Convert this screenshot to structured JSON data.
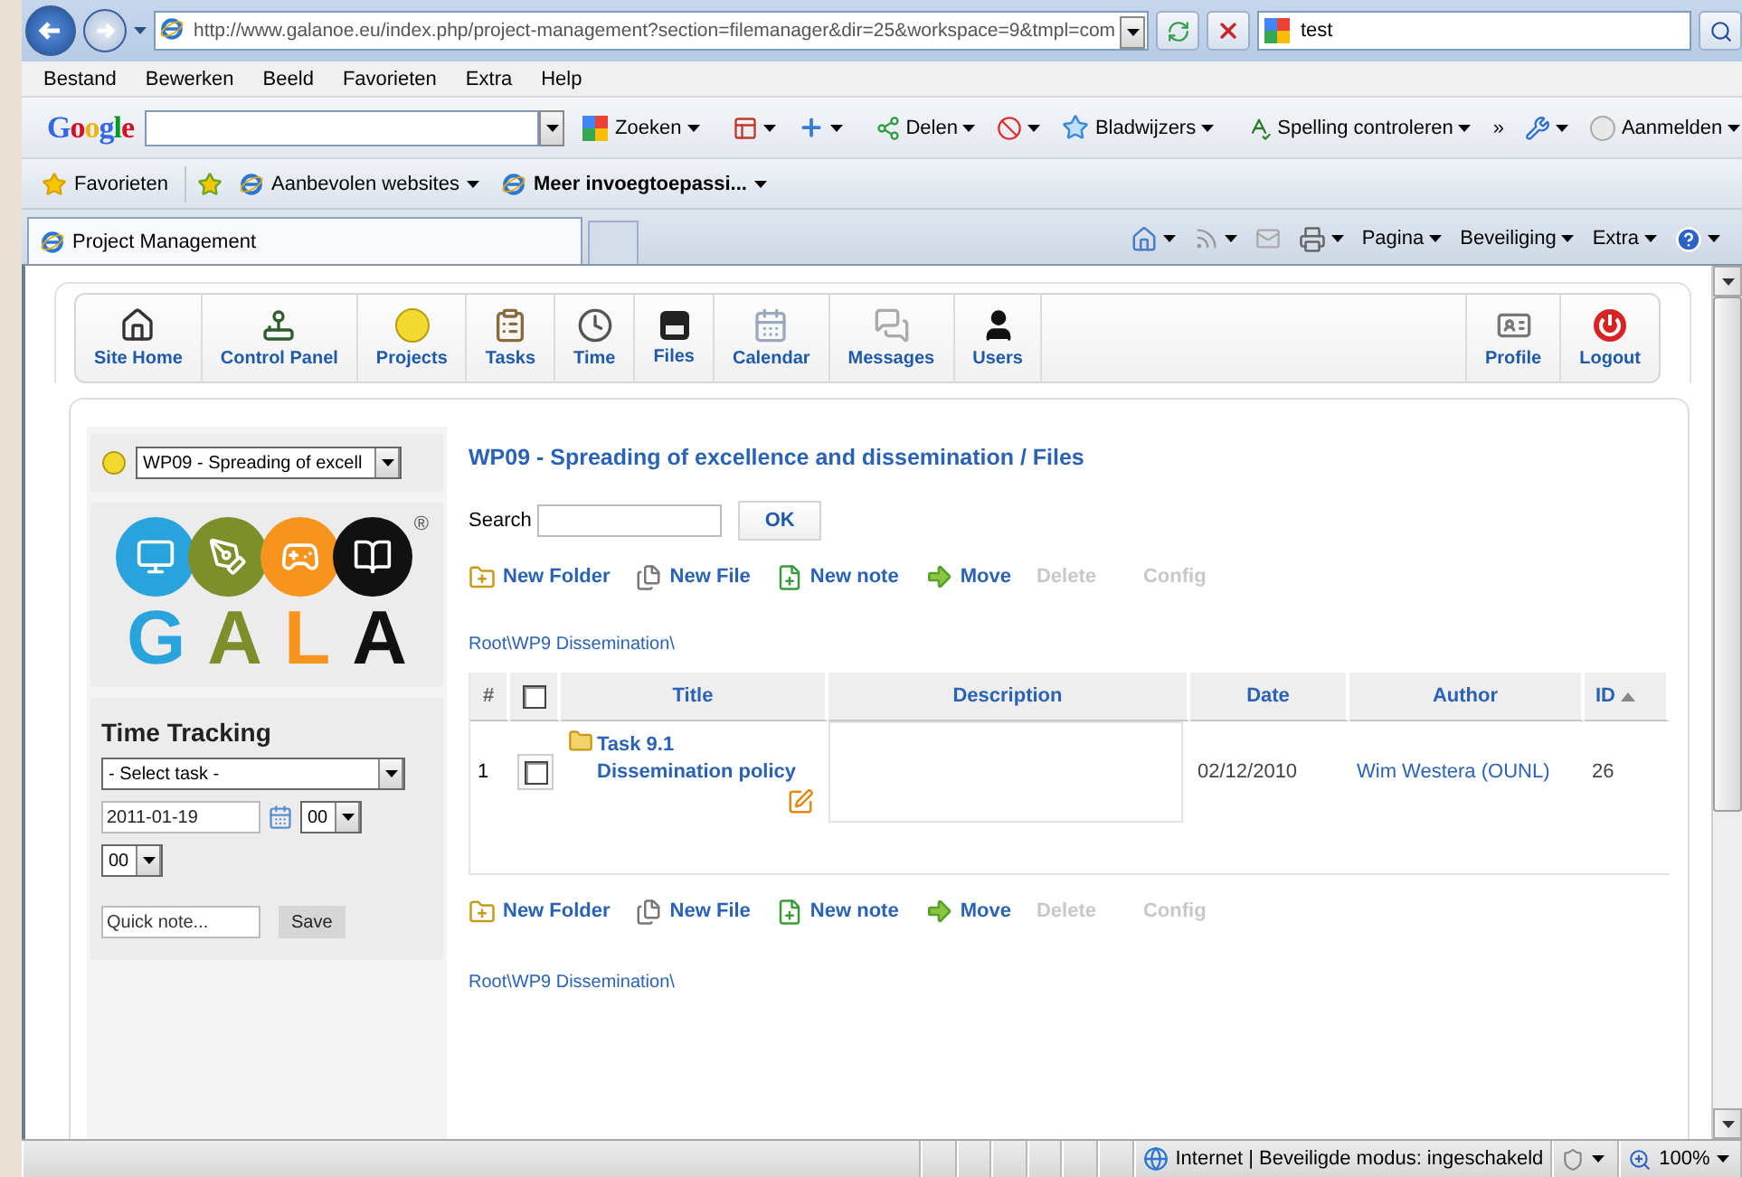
{
  "browser": {
    "address": "http://www.galanoe.eu/index.php/project-management?section=filemanager&dir=25&workspace=9&tmpl=com",
    "search": "test",
    "menu": [
      "Bestand",
      "Bewerken",
      "Beeld",
      "Favorieten",
      "Extra",
      "Help"
    ],
    "google_toolbar": {
      "logo": "Google",
      "items": [
        {
          "label": "Zoeken",
          "kind": "search"
        },
        {
          "kind": "page-tools"
        },
        {
          "kind": "add"
        },
        {
          "label": "Delen",
          "kind": "share"
        },
        {
          "kind": "blocker"
        },
        {
          "label": "Bladwijzers",
          "kind": "bookmarks"
        },
        {
          "label": "Spelling controleren",
          "kind": "spelling"
        },
        {
          "label": "»",
          "kind": "more"
        },
        {
          "kind": "wrench"
        },
        {
          "label": "Aanmelden",
          "kind": "signin"
        }
      ]
    },
    "favorites_bar": {
      "label": "Favorieten",
      "items": [
        {
          "label": "Aanbevolen websites",
          "bold": false
        },
        {
          "label": "Meer invoegtoepassi...",
          "bold": true
        }
      ]
    },
    "tabs": [
      {
        "label": "Project Management",
        "selected": true
      }
    ],
    "command_bar": [
      "Pagina",
      "Beveiliging",
      "Extra"
    ],
    "status_bar": {
      "zone": "Internet | Beveiligde modus: ingeschakeld",
      "zoom": "100%"
    }
  },
  "nav": {
    "left": [
      {
        "label": "Site Home",
        "kind": "home"
      },
      {
        "label": "Control Panel",
        "kind": "control"
      },
      {
        "label": "Projects",
        "kind": "projects"
      },
      {
        "label": "Tasks",
        "kind": "tasks"
      },
      {
        "label": "Time",
        "kind": "time"
      },
      {
        "label": "Files",
        "kind": "files"
      },
      {
        "label": "Calendar",
        "kind": "calendar"
      },
      {
        "label": "Messages",
        "kind": "messages"
      },
      {
        "label": "Users",
        "kind": "users"
      }
    ],
    "right": [
      {
        "label": "Profile",
        "kind": "profile"
      },
      {
        "label": "Logout",
        "kind": "logout"
      }
    ]
  },
  "sidebar": {
    "project_select": "WP09 - Spreading of excell",
    "logo": {
      "letters": [
        "G",
        "A",
        "L",
        "A"
      ],
      "mark": "®"
    },
    "time_tracking": {
      "title": "Time Tracking",
      "task_select": "- Select task -",
      "date": "2011-01-19",
      "hour": "00",
      "minute": "00",
      "quick_note": {
        "placeholder": "Quick note..."
      },
      "save": "Save"
    }
  },
  "main": {
    "title": "WP09 - Spreading of excellence and dissemination / Files",
    "search": {
      "label": "Search",
      "button": "OK"
    },
    "actions_top": [
      {
        "label": "New Folder",
        "kind": "folder",
        "disabled": false
      },
      {
        "label": "New File",
        "kind": "file",
        "disabled": false
      },
      {
        "label": "New note",
        "kind": "note",
        "disabled": false
      },
      {
        "label": "Move",
        "kind": "move",
        "disabled": false
      },
      {
        "label": "Delete",
        "disabled": true
      },
      {
        "label": "Config",
        "disabled": true
      }
    ],
    "path_top": "Root\\WP9 Dissemination\\",
    "table": {
      "header_checked": false,
      "columns": [
        {
          "label": "#",
          "kind": "number"
        },
        {
          "kind": "checkbox"
        },
        {
          "label": "Title",
          "kind": "title"
        },
        {
          "label": "Description",
          "kind": "description"
        },
        {
          "label": "Date",
          "kind": "date"
        },
        {
          "label": "Author",
          "kind": "author"
        },
        {
          "label": "ID",
          "kind": "id",
          "sorted": true
        }
      ],
      "rows": [
        {
          "number": "1",
          "checked": false,
          "title": "Task 9.1 Dissemination policy",
          "date": "02/12/2010",
          "author": "Wim Westera (OUNL)",
          "id": "26"
        }
      ]
    },
    "actions_bottom": [
      {
        "label": "New Folder",
        "kind": "folder",
        "disabled": false
      },
      {
        "label": "New File",
        "kind": "file",
        "disabled": false
      },
      {
        "label": "New note",
        "kind": "note",
        "disabled": false
      },
      {
        "label": "Move",
        "kind": "move",
        "disabled": false
      },
      {
        "label": "Delete",
        "disabled": true
      },
      {
        "label": "Config",
        "disabled": true
      }
    ],
    "path_bottom": "Root\\WP9 Dissemination\\"
  }
}
